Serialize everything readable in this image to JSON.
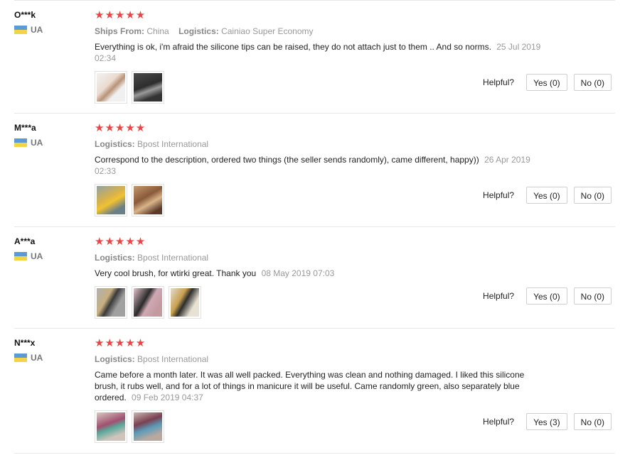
{
  "labels": {
    "ships_from": "Ships From:",
    "logistics": "Logistics:",
    "helpful": "Helpful?"
  },
  "colors": {
    "stars": "#e94545",
    "flag_top": "#5b9bd5",
    "flag_bottom": "#f1d548"
  },
  "reviews": [
    {
      "user": "O***k",
      "country": "UA",
      "stars": "★★★★★",
      "ships_from": "China",
      "logistics": "Cainiao Super Economy",
      "text": "Everything is ok, i'm afraid the silicone tips can be raised, they do not attach just to them .. And so norms.",
      "date": "25 Jul 2019 02:34",
      "photos": [
        "photo-brush-pink",
        "photo-brush-dark"
      ],
      "yes": "Yes (0)",
      "no": "No (0)"
    },
    {
      "user": "M***a",
      "country": "UA",
      "stars": "★★★★★",
      "logistics": "Bpost International",
      "text": "Correspond to the description, ordered two things (the seller sends randomly), came different, happy))",
      "date": "26 Apr 2019 02:33",
      "photos": [
        "photo-package-yellow",
        "photo-package-tan"
      ],
      "yes": "Yes (0)",
      "no": "No (0)"
    },
    {
      "user": "A***a",
      "country": "UA",
      "stars": "★★★★★",
      "logistics": "Bpost International",
      "text": "Very cool brush, for wtirki great. Thank you",
      "date": "08 May 2019 07:03",
      "photos": [
        "photo-brushes-gray",
        "photo-brushes-pink",
        "photo-brushes-light"
      ],
      "yes": "Yes (0)",
      "no": "No (0)"
    },
    {
      "user": "N***x",
      "country": "UA",
      "stars": "★★★★★",
      "logistics": "Bpost International",
      "text": "Came before a month later. It was all well packed. Everything was clean and nothing damaged. I liked this silicone brush, it rubs well, and for a lot of things in manicure it will be useful. Came randomly green, also separately blue ordered.",
      "date": "09 Feb 2019 04:37",
      "photos": [
        "photo-brush-green",
        "photo-brush-blue"
      ],
      "yes": "Yes (3)",
      "no": "No (0)"
    }
  ]
}
